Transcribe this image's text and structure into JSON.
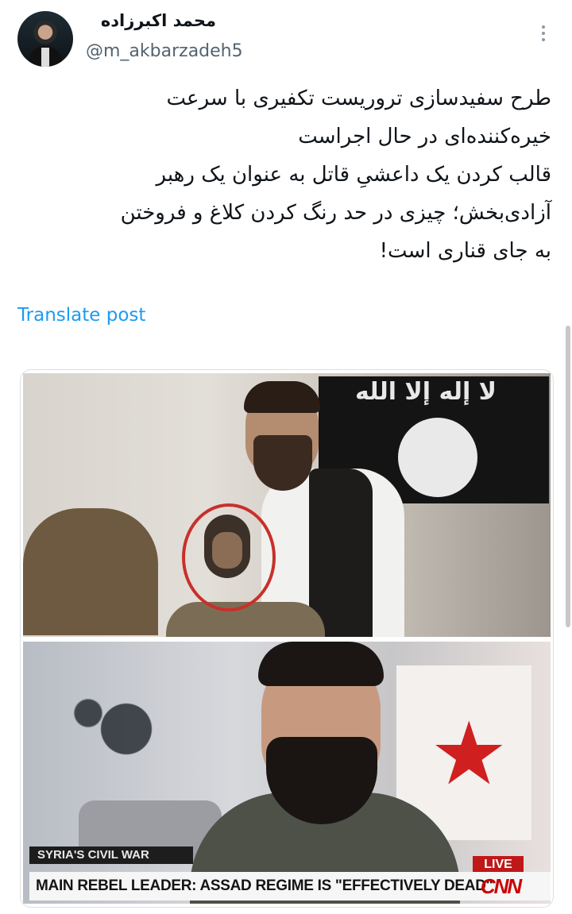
{
  "author": {
    "display_name": "محمد اکبرزاده",
    "handle": "@m_akbarzadeh5"
  },
  "post": {
    "lines": [
      "طرح سفیدسازی تروریست تکفیری با سرعت",
      "خیره‌کننده‌ای در حال اجراست",
      "قالب کردن یک داعشیِ قاتل به عنوان یک رهبر",
      "آزادی‌بخش؛ چیزی در حد رنگ کردن کلاغ و فروختن",
      "به جای قناری است!"
    ],
    "translate_label": "Translate post"
  },
  "media": {
    "photo1": {
      "flag_text": "لا إله إلا الله"
    },
    "photo2": {
      "chyron_top": "SYRIA'S CIVIL WAR",
      "live": "LIVE",
      "chyron_main": "MAIN REBEL LEADER: ASSAD REGIME IS \"EFFECTIVELY DEAD\"",
      "network_logo": "CNN"
    }
  },
  "colors": {
    "link": "#1d9bf0",
    "secondary_text": "#536471",
    "live_red": "#c01818",
    "highlight_circle": "#c8302a"
  },
  "icons": {
    "more": "more-vertical-icon"
  }
}
